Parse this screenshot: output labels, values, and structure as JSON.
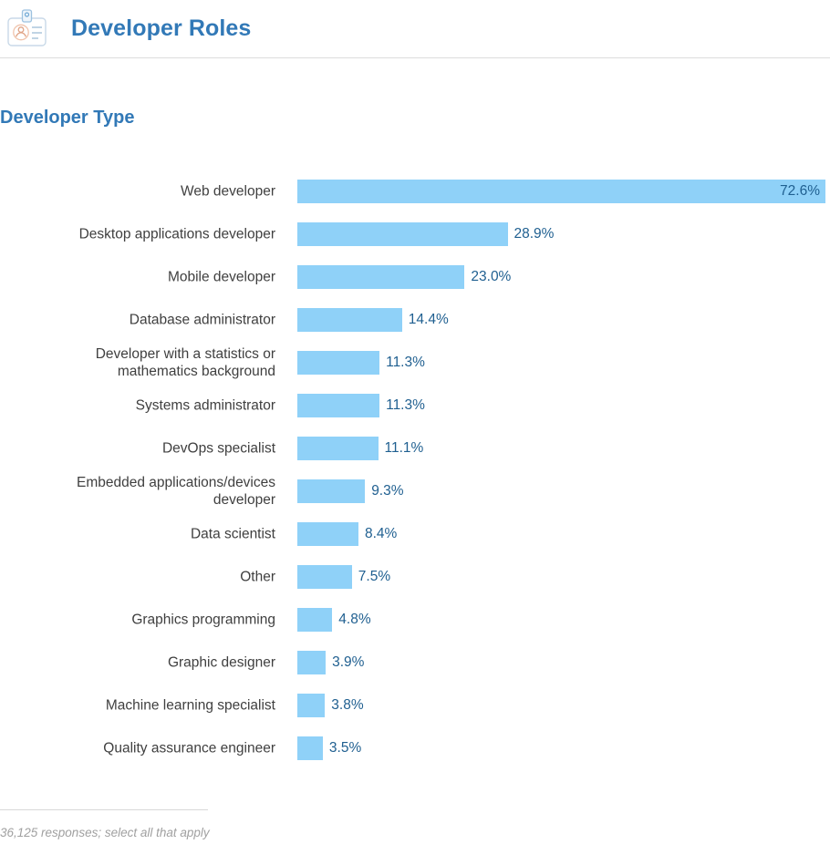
{
  "header": {
    "title": "Developer Roles",
    "icon": "id-badge-icon"
  },
  "section": {
    "title": "Developer Type"
  },
  "footer": {
    "note": "36,125 responses; select all that apply"
  },
  "colors": {
    "title_blue": "#3279b7",
    "bar_fill": "#8fd1f8",
    "value_text": "#1f5f90",
    "label_text": "#3f3f3f",
    "footer_text": "#a0a0a0",
    "rule": "#dcdcdc"
  },
  "chart_data": {
    "type": "bar",
    "orientation": "horizontal",
    "title": "Developer Type",
    "xlabel": "",
    "ylabel": "",
    "xlim": [
      0,
      72.6
    ],
    "grid": false,
    "legend": false,
    "value_suffix": "%",
    "categories": [
      "Web developer",
      "Desktop applications developer",
      "Mobile developer",
      "Database administrator",
      "Developer with a statistics or\nmathematics background",
      "Systems administrator",
      "DevOps specialist",
      "Embedded applications/devices\ndeveloper",
      "Data scientist",
      "Other",
      "Graphics programming",
      "Graphic designer",
      "Machine learning specialist",
      "Quality assurance engineer"
    ],
    "values": [
      72.6,
      28.9,
      23.0,
      14.4,
      11.3,
      11.3,
      11.1,
      9.3,
      8.4,
      7.5,
      4.8,
      3.9,
      3.8,
      3.5
    ],
    "value_labels": [
      "72.6%",
      "28.9%",
      "23.0%",
      "14.4%",
      "11.3%",
      "11.3%",
      "11.1%",
      "9.3%",
      "8.4%",
      "7.5%",
      "4.8%",
      "3.9%",
      "3.8%",
      "3.5%"
    ]
  }
}
